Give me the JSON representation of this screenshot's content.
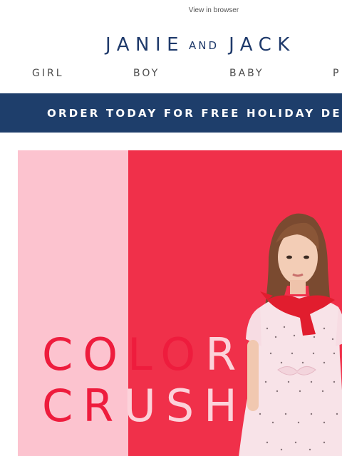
{
  "header": {
    "view_in_browser": "View in browser"
  },
  "logo": {
    "word1": "JANIE",
    "connector": "AND",
    "word2": "JACK",
    "color": "#1f3a6b"
  },
  "nav": {
    "items": [
      {
        "label": "GIRL"
      },
      {
        "label": "BOY"
      },
      {
        "label": "BABY"
      },
      {
        "label": "P"
      }
    ]
  },
  "banner": {
    "text": "ORDER TODAY FOR FREE HOLIDAY DELI",
    "background": "#1e3e6b"
  },
  "hero": {
    "line1": {
      "dark": "COLO",
      "light": "R"
    },
    "line2": {
      "dark_a": "CR",
      "light": "USH",
      "dark_b": ""
    },
    "colors": {
      "left_panel": "#fcc3cf",
      "right_panel": "#f0304a",
      "headline_strong": "#ee1c3d",
      "headline_soft": "#fcd2da"
    }
  }
}
